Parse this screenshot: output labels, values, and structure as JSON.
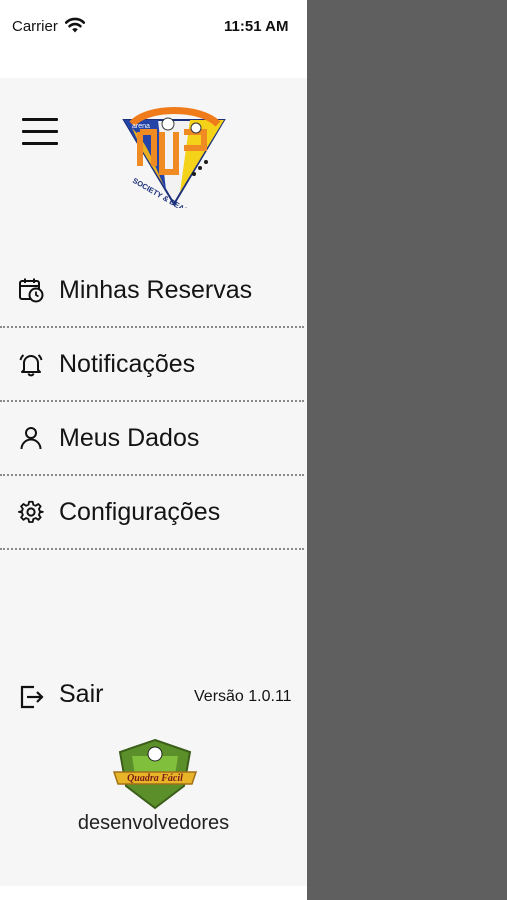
{
  "status_bar": {
    "carrier": "Carrier",
    "time": "11:51 AM",
    "wifi_icon": "wifi-icon"
  },
  "header": {
    "menu_icon": "hamburger-icon",
    "logo": {
      "top_text": "arena",
      "badge_text": "SOCIETY & BEACH SPORTS"
    }
  },
  "menu": {
    "items": [
      {
        "label": "Minhas Reservas",
        "icon": "calendar-clock-icon"
      },
      {
        "label": "Notificações",
        "icon": "bell-icon"
      },
      {
        "label": "Meus Dados",
        "icon": "user-icon"
      },
      {
        "label": "Configurações",
        "icon": "gear-icon"
      }
    ]
  },
  "footer": {
    "logout_label": "Sair",
    "logout_icon": "logout-icon",
    "version": "Versão 1.0.11",
    "developer_logo_text": "Quadra Fácil",
    "developer_label": "desenvolvedores"
  },
  "colors": {
    "drawer_bg": "#f6f6f6",
    "overlay": "#5f5f5f",
    "text": "#141414"
  }
}
